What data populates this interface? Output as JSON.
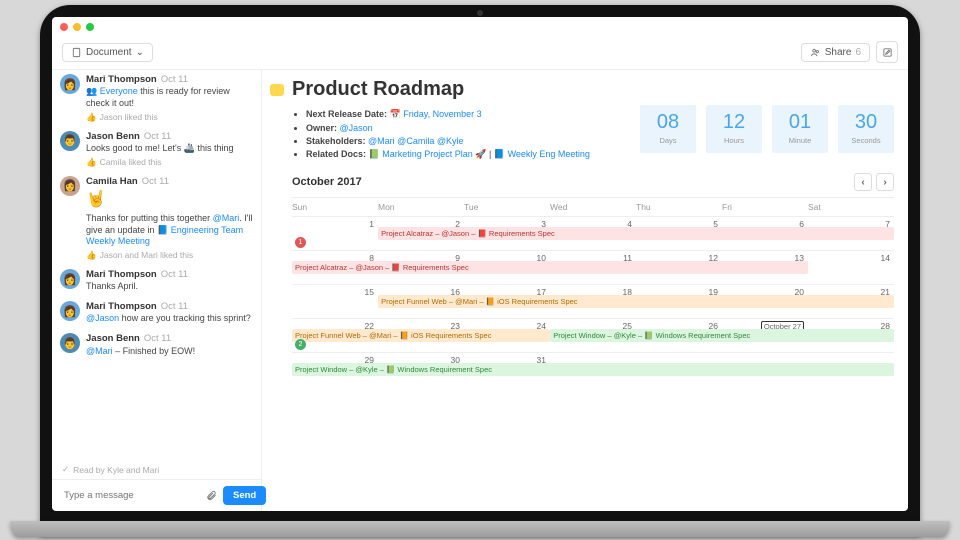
{
  "toolbar": {
    "doc_label": "Document",
    "share_label": "Share",
    "share_count": "6"
  },
  "messages": [
    {
      "author": "Mari Thompson",
      "time": "Oct 11",
      "avatar_bg": "#6aa8d8",
      "body_prefix": "",
      "mention": "👥 Everyone",
      "body_after": " this is ready for review check it out!",
      "liked": "Jason liked this"
    },
    {
      "author": "Jason Benn",
      "time": "Oct 11",
      "avatar_bg": "#4e8bb3",
      "body_prefix": "Looks good to me! Let's 🚢 this thing",
      "liked": "Camila liked this"
    },
    {
      "author": "Camila Han",
      "time": "Oct 11",
      "avatar_bg": "#c9a58f",
      "emoji": "🤘",
      "body2_before": "Thanks for putting this together ",
      "body2_mention": "@Mari",
      "body2_after": ". I'll give an update in ",
      "body2_link": "📘 Engineering Team Weekly Meeting",
      "liked": "Jason and Mari liked this"
    },
    {
      "author": "Mari Thompson",
      "time": "Oct 11",
      "avatar_bg": "#6aa8d8",
      "body_prefix": "Thanks April."
    },
    {
      "author": "Mari Thompson",
      "time": "Oct 11",
      "avatar_bg": "#6aa8d8",
      "mention": "@Jason",
      "body_after": " how are you tracking this sprint?"
    },
    {
      "author": "Jason Benn",
      "time": "Oct 11",
      "avatar_bg": "#4e8bb3",
      "mention": "@Mari",
      "body_after": " – Finished by EOW!"
    }
  ],
  "read_receipt": "Read by Kyle and Mari",
  "compose": {
    "placeholder": "Type a message",
    "send": "Send"
  },
  "page_title": "Product Roadmap",
  "bullets": {
    "release_label": "Next Release Date:",
    "release_val": "📅 Friday, November 3",
    "owner_label": "Owner:",
    "owner_val": "@Jason",
    "stake_label": "Stakeholders:",
    "stake_val": "@Mari @Camila @Kyle",
    "docs_label": "Related Docs:",
    "docs_val1": "📗 Marketing Project Plan 🚀",
    "docs_sep": " | ",
    "docs_val2": "📘 Weekly Eng Meeting"
  },
  "countdown": [
    {
      "num": "08",
      "label": "Days"
    },
    {
      "num": "12",
      "label": "Hours"
    },
    {
      "num": "01",
      "label": "Minute"
    },
    {
      "num": "30",
      "label": "Seconds"
    }
  ],
  "cal_title": "October 2017",
  "dow": [
    "Sun",
    "Mon",
    "Tue",
    "Wed",
    "Thu",
    "Fri",
    "Sat"
  ],
  "events": {
    "e1": "Project Alcatraz – @Jason – 📕 Requirements Spec",
    "e1b": "Project Alcatraz – @Jason – 📕 Requirements Spec",
    "e2": "Project Funnel Web – @Mari – 📙 iOS Requirements Spec",
    "e2b": "Project Funnel Web – @Mari – 📙 iOS Requirements Spec",
    "e3": "Project Window – @Kyle – 📗 Windows Requirement Spec",
    "e3b": "Project Window – @Kyle – 📗 Windows Requirement Spec"
  },
  "today_label": "October 27"
}
